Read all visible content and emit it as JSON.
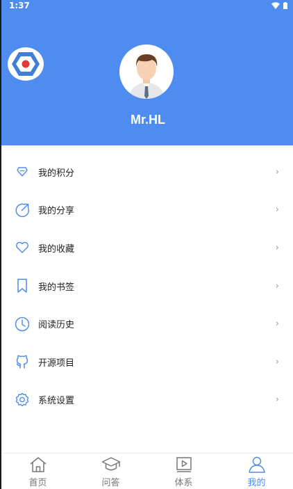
{
  "status_bar": {
    "time": "1:37"
  },
  "profile": {
    "username": "Mr.HL"
  },
  "menu": [
    {
      "label": "我的积分",
      "icon": "diamond-icon"
    },
    {
      "label": "我的分享",
      "icon": "share-icon"
    },
    {
      "label": "我的收藏",
      "icon": "heart-icon"
    },
    {
      "label": "我的书签",
      "icon": "bookmark-icon"
    },
    {
      "label": "阅读历史",
      "icon": "clock-icon"
    },
    {
      "label": "开源项目",
      "icon": "github-icon"
    },
    {
      "label": "系统设置",
      "icon": "settings-icon"
    }
  ],
  "arrow": "›",
  "tabs": [
    {
      "label": "首页",
      "icon": "home-icon",
      "active": false
    },
    {
      "label": "问答",
      "icon": "graduation-cap-icon",
      "active": false
    },
    {
      "label": "体系",
      "icon": "video-book-icon",
      "active": false
    },
    {
      "label": "我的",
      "icon": "user-icon",
      "active": true
    }
  ],
  "colors": {
    "primary": "#4f8cf0",
    "text": "#222222",
    "inactive": "#777777"
  }
}
